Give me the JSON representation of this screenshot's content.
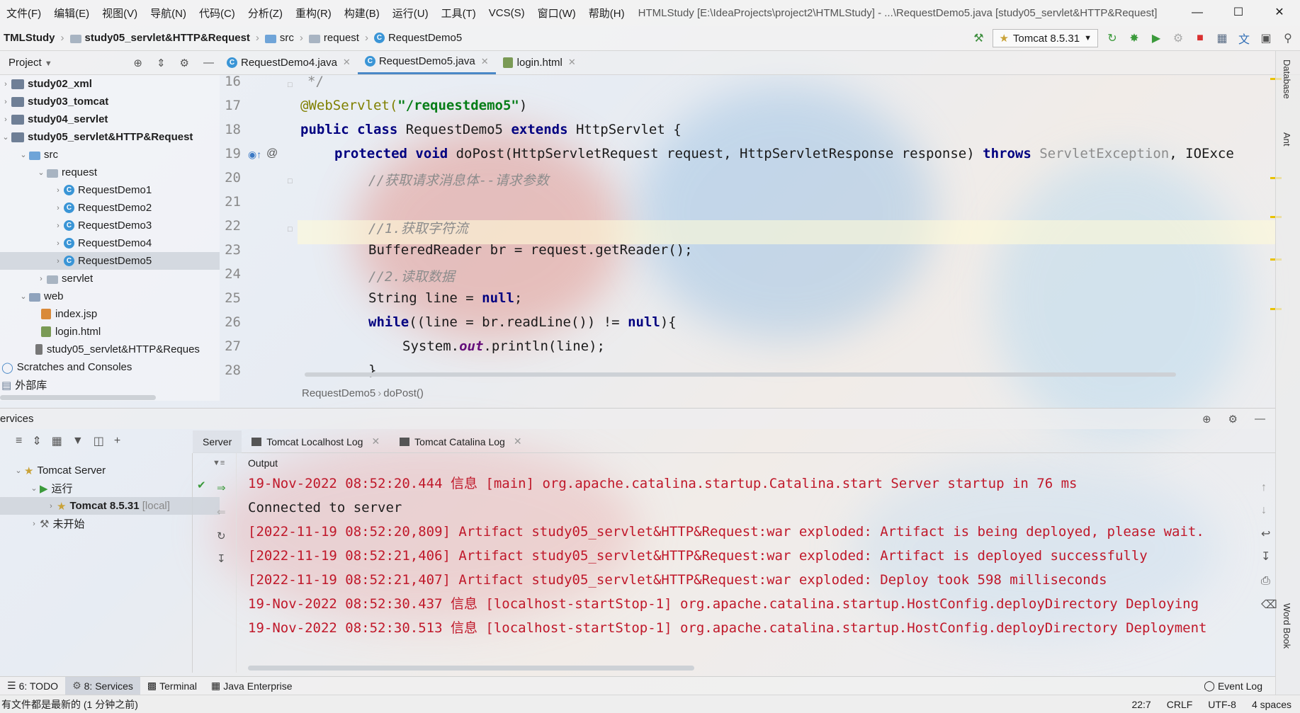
{
  "menu": [
    "文件(F)",
    "编辑(E)",
    "视图(V)",
    "导航(N)",
    "代码(C)",
    "分析(Z)",
    "重构(R)",
    "构建(B)",
    "运行(U)",
    "工具(T)",
    "VCS(S)",
    "窗口(W)",
    "帮助(H)"
  ],
  "window_title": "HTMLStudy [E:\\IdeaProjects\\project2\\HTMLStudy] - ...\\RequestDemo5.java [study05_servlet&HTTP&Request]",
  "breadcrumbs": {
    "project": "TMLStudy",
    "module": "study05_servlet&HTTP&Request",
    "src": "src",
    "pkg": "request",
    "cls": "RequestDemo5"
  },
  "run_config": "Tomcat 8.5.31",
  "project_panel": {
    "title": "Project"
  },
  "tree": [
    {
      "label": "study02_xml"
    },
    {
      "label": "study03_tomcat"
    },
    {
      "label": "study04_servlet"
    },
    {
      "label": "study05_servlet&HTTP&Request"
    },
    {
      "label": "src"
    },
    {
      "label": "request"
    },
    {
      "label": "RequestDemo1"
    },
    {
      "label": "RequestDemo2"
    },
    {
      "label": "RequestDemo3"
    },
    {
      "label": "RequestDemo4"
    },
    {
      "label": "RequestDemo5"
    },
    {
      "label": "servlet"
    },
    {
      "label": "web"
    },
    {
      "label": "index.jsp"
    },
    {
      "label": "login.html"
    },
    {
      "label": "study05_servlet&HTTP&Reques"
    },
    {
      "label": "Scratches and Consoles"
    },
    {
      "label": "外部库"
    }
  ],
  "tabs": [
    "RequestDemo4.java",
    "RequestDemo5.java",
    "login.html"
  ],
  "line_numbers": [
    "16",
    "17",
    "18",
    "19",
    "20",
    "21",
    "22",
    "23",
    "24",
    "25",
    "26",
    "27",
    "28"
  ],
  "code": {
    "l16": "*/",
    "l17_ann": "@WebServlet(",
    "l17_str": "\"/requestdemo5\"",
    "l17_end": ")",
    "l18_kw1": "public class",
    "l18_mid": " RequestDemo5 ",
    "l18_kw2": "extends",
    "l18_end": " HttpServlet {",
    "l19_kw": "protected void",
    "l19_mid": " doPost(HttpServletRequest request, HttpServletResponse response) ",
    "l19_kw2": "throws",
    "l19_grey": " ServletException",
    "l19_end": ", IOExce",
    "l20": "//获取请求消息体--请求参数",
    "l22": "//1.获取字符流",
    "l23": "BufferedReader br = request.getReader();",
    "l24": "//2.读取数据",
    "l25_a": "String line = ",
    "l25_kw": "null",
    "l25_b": ";",
    "l26_kw": "while",
    "l26_a": "((line = br.readLine()) != ",
    "l26_kw2": "null",
    "l26_b": "){",
    "l27_a": "System.",
    "l27_fld": "out",
    "l27_b": ".println(line);",
    "l28": "}"
  },
  "editor_crumb": [
    "RequestDemo5",
    "doPost()"
  ],
  "right_strip": [
    "Database",
    "Ant",
    "Word Book"
  ],
  "services": {
    "title": "ervices",
    "tree": {
      "server": "Tomcat Server",
      "running": "运行",
      "instance": "Tomcat 8.5.31",
      "instance_tag": "[local]",
      "not_started": "未开始"
    },
    "tabs": [
      "Server",
      "Tomcat Localhost Log",
      "Tomcat Catalina Log"
    ],
    "output_label": "Output",
    "console": [
      {
        "text": "19-Nov-2022 08:52:20.444 信息 [main] org.apache.catalina.startup.Catalina.start Server startup in 76 ms",
        "color": "red"
      },
      {
        "text": "Connected to server",
        "color": "black"
      },
      {
        "text": "[2022-11-19 08:52:20,809] Artifact study05_servlet&HTTP&Request:war exploded: Artifact is being deployed, please wait.",
        "color": "red"
      },
      {
        "text": "[2022-11-19 08:52:21,406] Artifact study05_servlet&HTTP&Request:war exploded: Artifact is deployed successfully",
        "color": "red"
      },
      {
        "text": "[2022-11-19 08:52:21,407] Artifact study05_servlet&HTTP&Request:war exploded: Deploy took 598 milliseconds",
        "color": "red"
      },
      {
        "text": "19-Nov-2022 08:52:30.437 信息 [localhost-startStop-1] org.apache.catalina.startup.HostConfig.deployDirectory Deploying",
        "color": "red"
      },
      {
        "text": "19-Nov-2022 08:52:30.513 信息 [localhost-startStop-1] org.apache.catalina.startup.HostConfig.deployDirectory Deployment",
        "color": "red"
      }
    ]
  },
  "toolwindows": {
    "todo": "6: TODO",
    "services": "8: Services",
    "terminal": "Terminal",
    "java_ee": "Java Enterprise",
    "event_log": "Event Log"
  },
  "status": {
    "message": "有文件都是最新的 (1 分钟之前)",
    "position": "22:7",
    "line_sep": "CRLF",
    "encoding": "UTF-8",
    "indent": "4 spaces"
  },
  "colors": {
    "accent": "#4a88c7",
    "console_red": "#c0182a",
    "string_green": "#067d17",
    "keyword_navy": "#000080"
  }
}
